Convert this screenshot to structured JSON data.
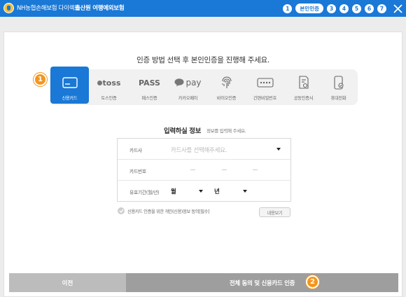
{
  "header": {
    "brand": "NH농협손해보험 다이렉트",
    "title": "출산원 여행예외보험",
    "steps": [
      "1",
      "본인인증",
      "3",
      "4",
      "5",
      "6",
      "7"
    ]
  },
  "main": {
    "headline": "인증 방법 선택 후 본인인증을 진행해 주세요.",
    "methods": [
      {
        "label": "신용카드",
        "icon": "credit-card-icon",
        "active": true
      },
      {
        "label": "토스인증",
        "icon": "toss-logo",
        "logo": "toss"
      },
      {
        "label": "패스인증",
        "icon": "pass-logo",
        "logo": "PASS"
      },
      {
        "label": "카카오페이",
        "icon": "kakaopay-logo",
        "logo": "pay"
      },
      {
        "label": "바이오인증",
        "icon": "fingerprint-icon"
      },
      {
        "label": "간편비밀번호",
        "icon": "pin-icon"
      },
      {
        "label": "공동인증서",
        "icon": "certificate-icon"
      },
      {
        "label": "휴대전화",
        "icon": "phone-icon"
      }
    ],
    "badge1": "1",
    "section_title": "입력하실 정보",
    "section_sub": "정보를 입력해 주세요.",
    "form": {
      "card_company_label": "카드사",
      "card_company_placeholder": "카드사를 선택해주세요.",
      "card_number_label": "카드번호",
      "card_number_dashes": [
        "—",
        "—",
        "—"
      ],
      "expiry_label": "유효기간(월/년)",
      "month_label": "월",
      "year_label": "년"
    },
    "agree_text": "신용카드 인증을 위한 개인(신용)정보 동의[필수]",
    "view_button": "내용보기"
  },
  "footer": {
    "prev_label": "이전",
    "next_label": "전체 동의 및 신용카드 인증",
    "badge2": "2"
  },
  "colors": {
    "primary": "#1a78d6",
    "badge": "#f3961f",
    "prev_bg": "#bcbcbc",
    "next_bg": "#9e9e9e",
    "methods_bg": "#f1f1f1"
  }
}
